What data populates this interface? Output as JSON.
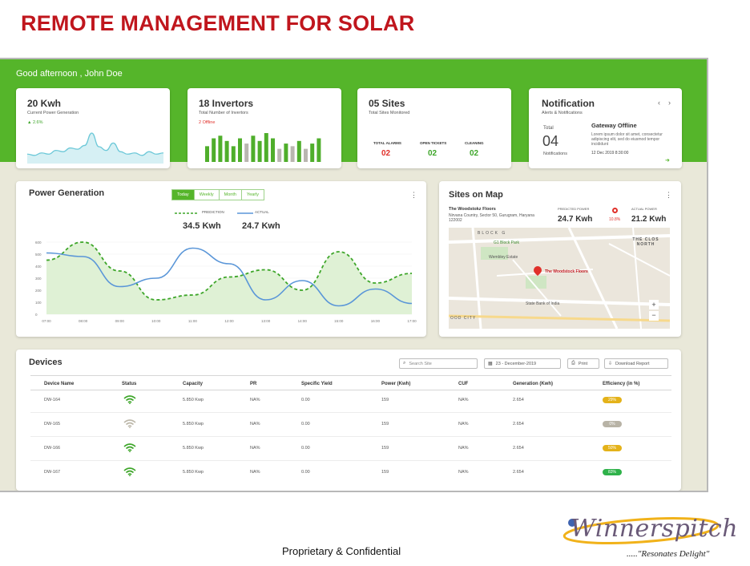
{
  "slide": {
    "title": "REMOTE MANAGEMENT FOR SOLAR",
    "footer": "Proprietary & Confidential",
    "logo_text": "Winnerspitch",
    "tagline": ".....\"Resonates Delight\""
  },
  "dashboard": {
    "greeting": "Good afternoon , John Doe",
    "colors": {
      "brand_green": "#55b52a",
      "alarm_red": "#e0302a",
      "header_title_red": "#c0161d"
    },
    "kpis": {
      "power": {
        "title": "20 Kwh",
        "subtitle": "Current Power Generation",
        "delta": "▲ 2.6%"
      },
      "invertors": {
        "title": "18 Invertors",
        "subtitle": "Total Number of Invertors",
        "offline": "2 Offline"
      },
      "sites": {
        "title": "05 Sites",
        "subtitle": "Total Sites Monitored",
        "tickets": [
          {
            "label": "TOTAL ALARMS",
            "value": "02"
          },
          {
            "label": "OPEN TICKETS",
            "value": "02"
          },
          {
            "label": "CLEANING",
            "value": "02"
          }
        ]
      },
      "notification": {
        "title": "Notification",
        "subtitle": "Alerts & Notifications",
        "total_label": "Total",
        "total_value": "04",
        "total_unit": "Notifications",
        "item_title": "Gateway Offline",
        "item_text": "Lorem ipsum dolor sit amet, consectetur adipiscing elit, sed do eiusmod tempor incididunt",
        "item_date": "12 Dec 2019 8:30:00"
      }
    },
    "power_generation": {
      "title": "Power Generation",
      "tabs": [
        "Today",
        "Weekly",
        "Month",
        "Yearly"
      ],
      "active_tab": "Today",
      "legend": [
        {
          "label": "PREDICTION",
          "value": "34.5 Kwh"
        },
        {
          "label": "ACTUAL",
          "value": "24.7 Kwh"
        }
      ]
    },
    "sites_on_map": {
      "title": "Sites on Map",
      "site_name": "The Woodstokz Floors",
      "site_address": "Nirvana Country, Sector 50, Gurugram, Haryana 122002",
      "predicted_label": "PREDICTED POWER",
      "predicted_value": "24.7 Kwh",
      "delta": "10.8%",
      "actual_label": "ACTUAL POWER",
      "actual_value": "21.2 Kwh",
      "map_labels": [
        "BLOCK G",
        "G1 Block Park",
        "Wembley Estate",
        "The Woodstock Floors",
        "THE CLOS NORTH",
        "State Bank of India",
        "OOD CITY"
      ]
    },
    "devices": {
      "title": "Devices",
      "search_placeholder": "Search Site",
      "date": "23 - December-2019",
      "print_label": "Print",
      "download_label": "Download Report",
      "columns": [
        "Device Name",
        "Status",
        "Capacity",
        "PR",
        "Specific Yield",
        "Power (Kwh)",
        "CUF",
        "Generation (Kwh)",
        "Efficiency (in %)"
      ],
      "rows": [
        {
          "name": "DW-164",
          "status": "online",
          "capacity": "5.850 Kwp",
          "pr": "NA%",
          "yield": "0.00",
          "power": "159",
          "cuf": "NA%",
          "generation": "2.654",
          "efficiency": "29%",
          "eff_color": "#e4b21a"
        },
        {
          "name": "DW-165",
          "status": "offline",
          "capacity": "5.850 Kwp",
          "pr": "NA%",
          "yield": "0.00",
          "power": "159",
          "cuf": "NA%",
          "generation": "2.654",
          "efficiency": "0%",
          "eff_color": "#b8b3a6"
        },
        {
          "name": "DW-166",
          "status": "online",
          "capacity": "5.850 Kwp",
          "pr": "NA%",
          "yield": "0.00",
          "power": "159",
          "cuf": "NA%",
          "generation": "2.654",
          "efficiency": "50%",
          "eff_color": "#e4b21a"
        },
        {
          "name": "DW-167",
          "status": "online",
          "capacity": "5.850 Kwp",
          "pr": "NA%",
          "yield": "0.00",
          "power": "159",
          "cuf": "NA%",
          "generation": "2.654",
          "efficiency": "83%",
          "eff_color": "#2fb24a"
        }
      ]
    }
  },
  "chart_data": [
    {
      "type": "line",
      "title": "Power Generation",
      "x": [
        "07:00",
        "08:00",
        "09:00",
        "10:00",
        "11:00",
        "12:00",
        "13:00",
        "14:00",
        "15:00",
        "16:00",
        "17:00"
      ],
      "yticks": [
        "0",
        "100",
        "200",
        "300",
        "400",
        "500",
        "600"
      ],
      "ylim": [
        0,
        600
      ],
      "series": [
        {
          "name": "PREDICTION",
          "style": "dashed-area",
          "values": [
            450,
            600,
            360,
            120,
            160,
            310,
            370,
            200,
            520,
            260,
            340
          ]
        },
        {
          "name": "ACTUAL",
          "style": "solid",
          "values": [
            510,
            480,
            230,
            300,
            550,
            420,
            120,
            280,
            70,
            210,
            90
          ]
        }
      ]
    },
    {
      "type": "area",
      "title": "20 Kwh",
      "values": [
        5,
        4,
        6,
        5,
        8,
        7,
        10,
        9,
        12,
        22,
        11,
        8,
        14,
        7,
        5,
        6,
        4,
        7,
        5,
        6
      ]
    },
    {
      "type": "bar",
      "title": "18 Invertors",
      "values": [
        6,
        9,
        10,
        8,
        6,
        9,
        7,
        10,
        8,
        11,
        9,
        5,
        7,
        6,
        8,
        5,
        7,
        9
      ],
      "highlight": [
        false,
        false,
        false,
        false,
        false,
        false,
        true,
        false,
        false,
        false,
        false,
        true,
        false,
        true,
        false,
        true,
        false,
        false
      ]
    }
  ]
}
